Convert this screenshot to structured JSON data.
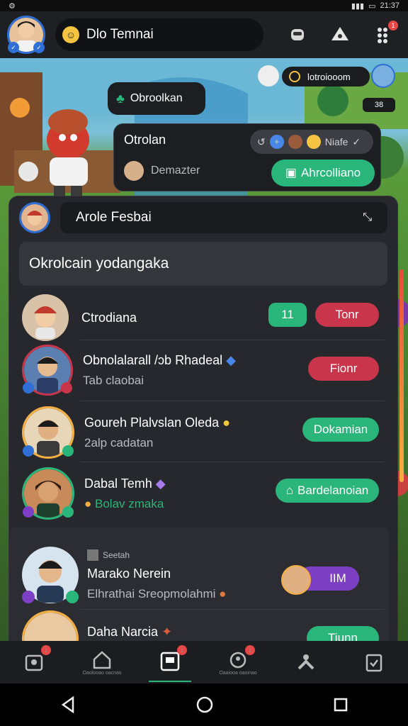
{
  "status": {
    "time": "21:37"
  },
  "topbar": {
    "title": "Dlo Temnai"
  },
  "scene": {
    "bubble_label": "Obroolkan",
    "header_chip_text": "lotroiooom",
    "count_text": "38"
  },
  "popup": {
    "title": "Otrolan",
    "chip_text": "Niafe",
    "member_name": "Demazter",
    "action_label": "Ahrcolliano"
  },
  "card": {
    "header_label": "Arole Fesbai",
    "section_title": "Okrolcain yodangaka",
    "rows": [
      {
        "name": "Ctrodiana",
        "sub": "",
        "badge": "11",
        "action": "Tonr"
      },
      {
        "name": "Obnolalarall /ɔb Rhadeal",
        "sub": "Tab claobai",
        "action": "Fionr"
      },
      {
        "name": "Goureh Plalvslan Oleda",
        "sub": "2alp cadatan",
        "action": "Dokamian"
      },
      {
        "name": "Dabal Temh",
        "sub": "Bolav  zmaka",
        "action": "Bardelanoian"
      },
      {
        "name": "Marako Nerein",
        "tag": "Seetah",
        "sub": "Elhrathai Sreopmolahmi",
        "action": "IIM"
      },
      {
        "name": "Daha Narcia",
        "sub": "",
        "action": "Tiunn"
      }
    ]
  },
  "nav": {
    "label_home": "Oaolooao oacnas",
    "label_friends": "Oaaiooa oaoinao"
  },
  "colors": {
    "green": "#2ab57a",
    "red": "#c9354a",
    "purple": "#7d3fc4"
  }
}
